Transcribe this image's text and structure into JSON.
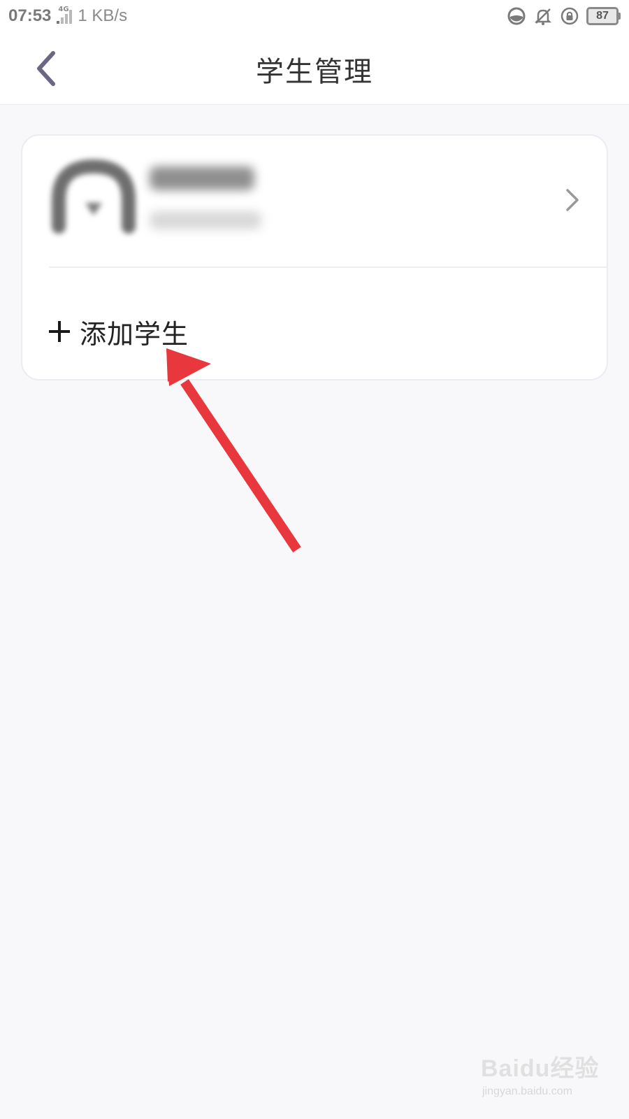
{
  "status_bar": {
    "time": "07:53",
    "network": "4G",
    "speed": "1 KB/s",
    "battery": "87"
  },
  "header": {
    "title": "学生管理",
    "back_icon": "chevron-left-icon"
  },
  "student_card": {
    "chevron_icon": "chevron-right-icon",
    "add_label": "添加学生",
    "add_icon": "plus-icon"
  },
  "annotation": {
    "arrow_color": "#e8383d"
  },
  "watermark": {
    "logo": "Baidu经验",
    "url": "jingyan.baidu.com"
  },
  "colors": {
    "background": "#f8f8fa",
    "card": "#ffffff",
    "title": "#333333",
    "back_icon": "#6b6682"
  }
}
